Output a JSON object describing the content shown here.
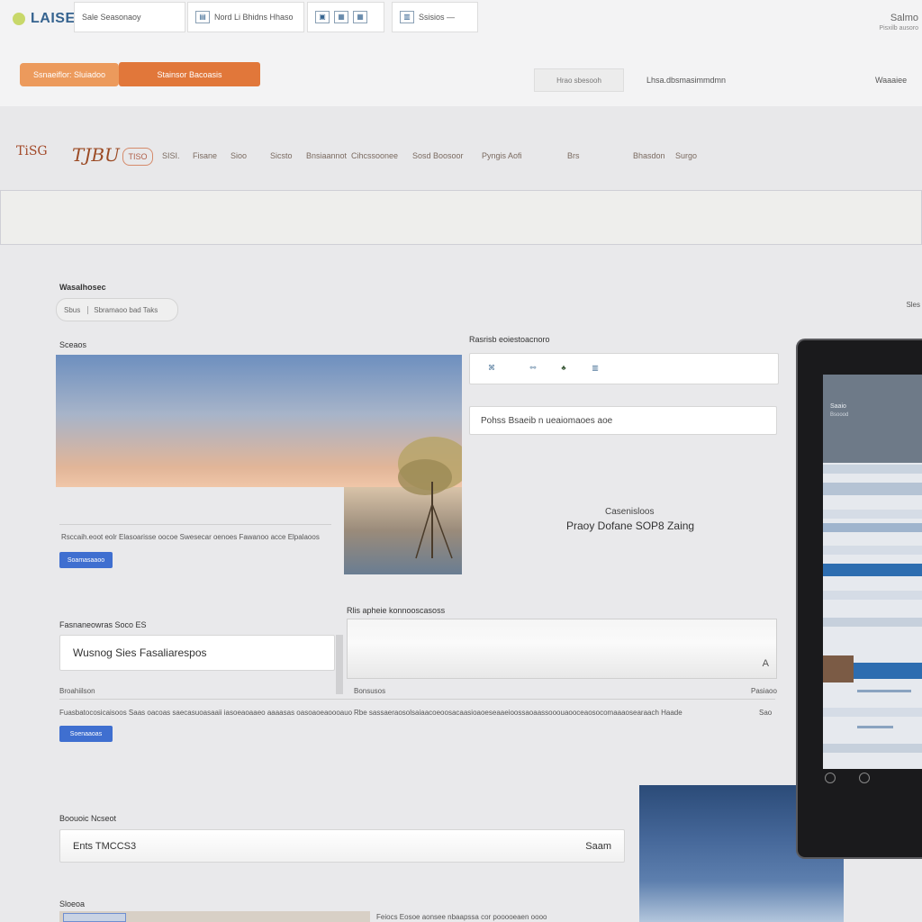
{
  "header": {
    "logo_text": "LAISE",
    "tabs": [
      {
        "icon": "",
        "label": "Sale Seasonaoy"
      },
      {
        "icon": "",
        "label": "Nord Li Bhidns Hhaso"
      },
      {
        "icon": "",
        "label": ""
      },
      {
        "icon": "",
        "label": "Ssisios —"
      }
    ],
    "right_title": "Salmo",
    "right_sub": "Pisxilb ausoro",
    "btn_light": "Ssnaeiflor: Sluiadoo",
    "btn_primary": "Stainsor Bacoasis",
    "util_box": "Hrao sbesooh",
    "util_links": [
      "Lhsa.dbsmasimmdmn",
      "Waaaiee"
    ]
  },
  "nav": {
    "logo_a": "TiSG",
    "logo_b": "TJBU",
    "badge": "TISO",
    "items": [
      "SISI.",
      "Fisane",
      "Sioo",
      "Sicsto",
      "Bnsiaannot",
      "Cihcssoonee",
      "Sosd Boosoor",
      "Pyngis Aofi",
      "Brs",
      "Bhasdon",
      "Surgo"
    ]
  },
  "main": {
    "section1_label": "Wasalhosec",
    "pill_left": "Sbus",
    "pill_right": "Sbramaoo bad Taks",
    "hero_label": "Sceaos",
    "hero_caption": "Rsccaih.eoot eolr Elasoarisse oocoe Swesecar oenoes Fawanoo acce Elpalaoos",
    "btn_1": "Soamasaaoo",
    "icons_label": "Rasrisb eoiestoacnoro",
    "icons": [
      "Swu",
      "Sso",
      "",
      "Saas"
    ],
    "search_text": "Pohss Bsaeib n ueaiomaoes aoe",
    "promo_title": "Casenisloos",
    "promo_sub": "Praoy Dofane SOP8 Zaing",
    "form1_label": "Fasnaneowras Soco ES",
    "input_a": "Wusnog Sies Fasaliarespos",
    "textarea_label": "Rlis apheie konnooscasoss",
    "textarea_char": "A",
    "row_label_left": "Broahiilson",
    "row_label_mid": "Bonsusos",
    "row_label_right": "Pasiaoo",
    "row_text_left": "Fuasbatocosicaisoos Saas oacoas saecasuoasaaii iasoeaoaaeo aaaasas oasoaoeaoooauo",
    "row_text_right": "Rbe sassaeraosolsaiaacoeoosacaasioaoeseaaeioossaoaassooouaooceaosocomaaaosearaach Haade",
    "row_text_right_end": "Sao",
    "btn_2": "Soenaaoas",
    "name_label": "Boouoic Ncseot",
    "name_value": "Ents TMCCS3",
    "name_suffix": "Saam",
    "bottom_label": "Sloeoa",
    "bottom_right": "Feiocs Eosoe aonsee nbaapssa cor pooooeaen oooo"
  },
  "tablet": {
    "header_title": "Saaio",
    "header_sub": "Bsoood"
  },
  "right_edge_label": "Sles"
}
